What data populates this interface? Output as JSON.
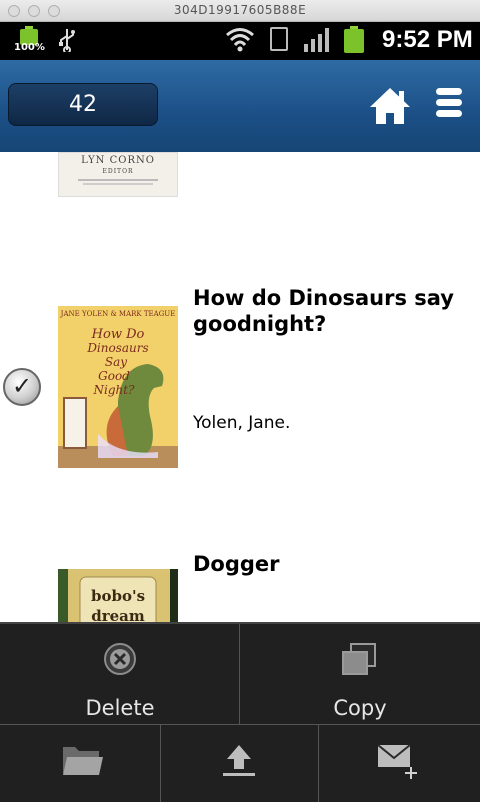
{
  "window": {
    "title": "304D19917605B88E"
  },
  "status_bar": {
    "battery_percent": "100%",
    "time": "9:52 PM"
  },
  "app_bar": {
    "counter": "42"
  },
  "books": [
    {
      "cover_lines": [
        "LYN CORNO",
        "EDITOR"
      ],
      "title": "",
      "author": "",
      "selected": false
    },
    {
      "cover_lines": [
        "JANE YOLEN & MARK TEAGUE",
        "How Do Dinosaurs Say Good Night?"
      ],
      "title": "How do Dinosaurs say goodnight?",
      "author": "Yolen, Jane.",
      "selected": true
    },
    {
      "cover_lines": [
        "bobo's dream"
      ],
      "title": "Dogger",
      "author": "",
      "selected": false
    }
  ],
  "actions": {
    "delete": "Delete",
    "copy": "Copy"
  },
  "icons": [
    "usb-icon",
    "wifi-icon",
    "sim-icon",
    "signal-icon",
    "home-icon",
    "list-menu-icon",
    "delete-icon",
    "copy-icon",
    "folder-icon",
    "upload-icon",
    "compose-mail-icon"
  ]
}
